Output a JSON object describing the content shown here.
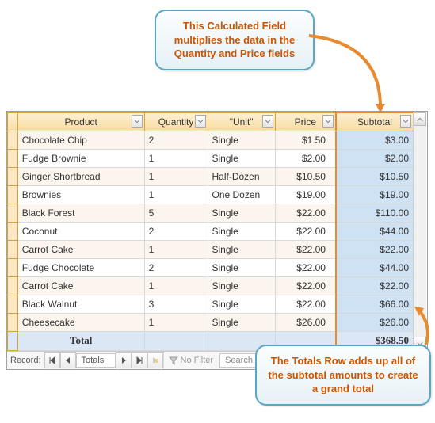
{
  "headers": {
    "product": "Product",
    "quantity": "Quantity",
    "unit": "\"Unit\"",
    "price": "Price",
    "subtotal": "Subtotal"
  },
  "rows": [
    {
      "product": "Chocolate Chip",
      "quantity": 2,
      "unit": "Single",
      "price": "$1.50",
      "subtotal": "$3.00"
    },
    {
      "product": "Fudge Brownie",
      "quantity": 1,
      "unit": "Single",
      "price": "$2.00",
      "subtotal": "$2.00"
    },
    {
      "product": "Ginger Shortbread",
      "quantity": 1,
      "unit": "Half-Dozen",
      "price": "$10.50",
      "subtotal": "$10.50"
    },
    {
      "product": "Brownies",
      "quantity": 1,
      "unit": "One Dozen",
      "price": "$19.00",
      "subtotal": "$19.00"
    },
    {
      "product": "Black Forest",
      "quantity": 5,
      "unit": "Single",
      "price": "$22.00",
      "subtotal": "$110.00"
    },
    {
      "product": "Coconut",
      "quantity": 2,
      "unit": "Single",
      "price": "$22.00",
      "subtotal": "$44.00"
    },
    {
      "product": "Carrot Cake",
      "quantity": 1,
      "unit": "Single",
      "price": "$22.00",
      "subtotal": "$22.00"
    },
    {
      "product": "Fudge Chocolate",
      "quantity": 2,
      "unit": "Single",
      "price": "$22.00",
      "subtotal": "$44.00"
    },
    {
      "product": "Carrot Cake",
      "quantity": 1,
      "unit": "Single",
      "price": "$22.00",
      "subtotal": "$22.00"
    },
    {
      "product": "Black Walnut",
      "quantity": 3,
      "unit": "Single",
      "price": "$22.00",
      "subtotal": "$66.00"
    },
    {
      "product": "Cheesecake",
      "quantity": 1,
      "unit": "Single",
      "price": "$26.00",
      "subtotal": "$26.00"
    }
  ],
  "total": {
    "label": "Total",
    "subtotal": "$368.50"
  },
  "nav": {
    "label": "Record:",
    "current": "Totals",
    "filter": "No Filter",
    "search": "Search"
  },
  "callouts": {
    "top": "This Calculated Field multiplies the data in the Quantity and Price fields",
    "bottom": "The Totals Row adds up all of the subtotal amounts to create a grand total"
  }
}
